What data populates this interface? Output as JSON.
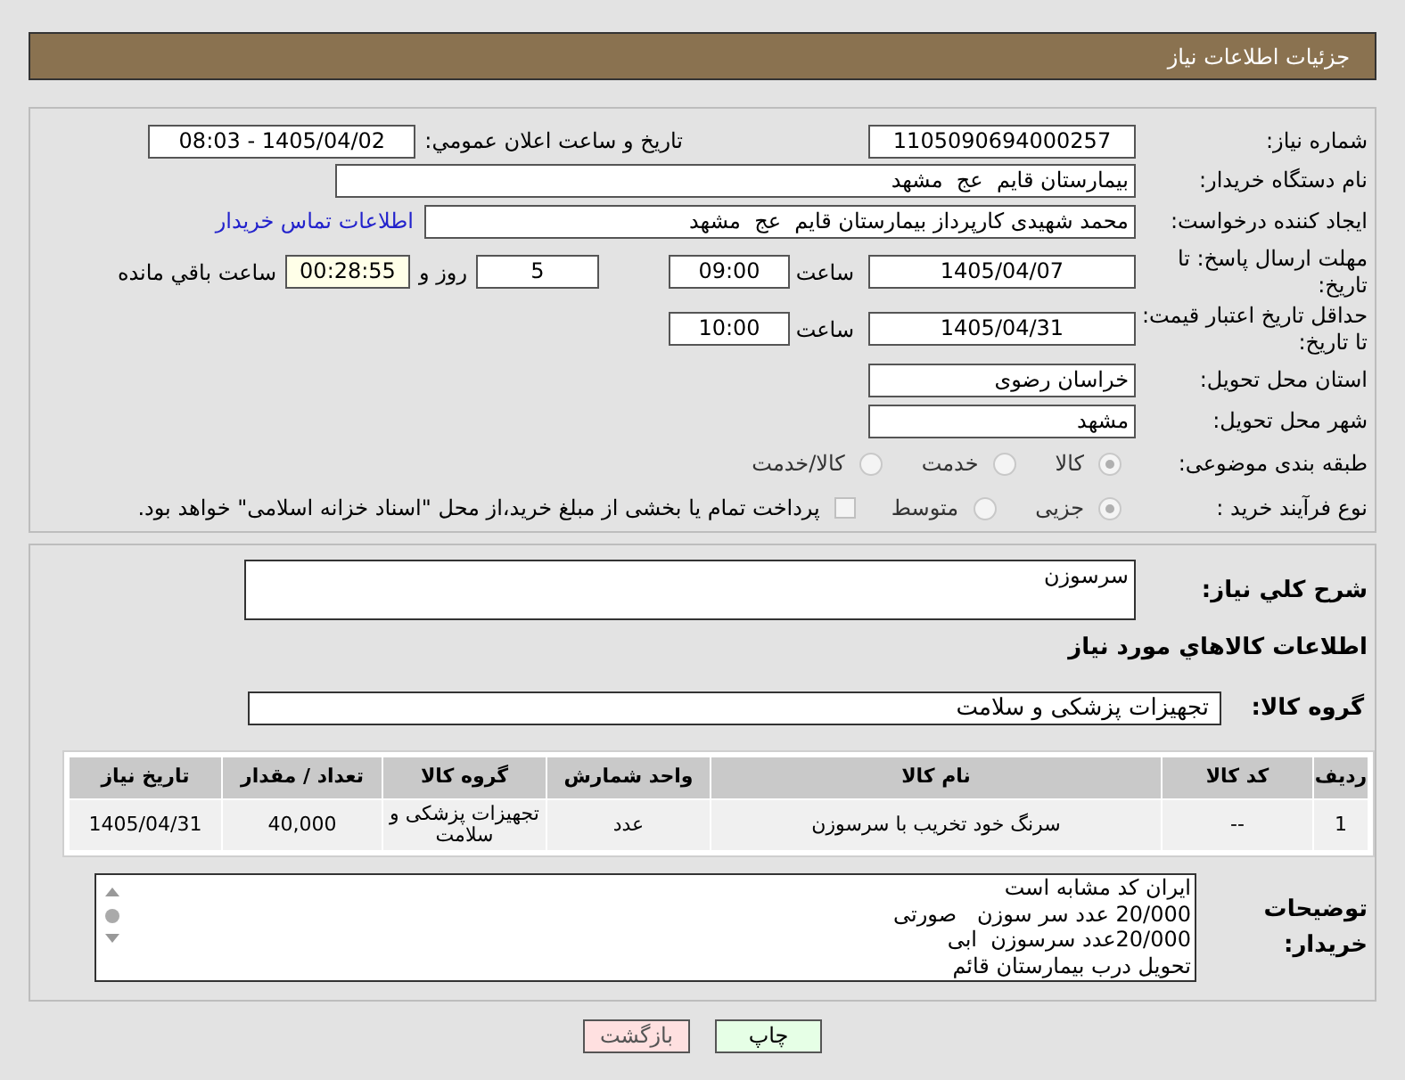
{
  "header": {
    "title": "جزئيات اطلاعات نياز"
  },
  "need_number": {
    "label": "شماره نياز:",
    "value": "1105090694000257"
  },
  "announce": {
    "label": "تاريخ و ساعت اعلان عمومي:",
    "value": "1405/04/02 - 08:03"
  },
  "buyer_org": {
    "label": "نام دستگاه خريدار:",
    "value": "بيمارستان قايم  عج  مشهد"
  },
  "requester": {
    "label": "ايجاد كننده درخواست:",
    "value": "محمد شهيدی كارپرداز بيمارستان قايم  عج  مشهد",
    "contact_link": "اطلاعات تماس خريدار"
  },
  "deadline": {
    "label": "مهلت ارسال پاسخ: تا تاريخ:",
    "date": "1405/04/07",
    "time_label": "ساعت",
    "time": "09:00",
    "days": "5",
    "days_label": "روز و",
    "remaining": "00:28:55",
    "remaining_label": "ساعت باقي مانده"
  },
  "validity": {
    "label": "حداقل تاريخ اعتبار قيمت: تا تاريخ:",
    "date": "1405/04/31",
    "time_label": "ساعت",
    "time": "10:00"
  },
  "province": {
    "label": "استان محل تحويل:",
    "value": "خراسان رضوی"
  },
  "city": {
    "label": "شهر محل تحويل:",
    "value": "مشهد"
  },
  "category": {
    "label": "طبقه بندی موضوعی:",
    "options": [
      {
        "label": "كالا",
        "selected": true
      },
      {
        "label": "خدمت",
        "selected": false
      },
      {
        "label": "كالا/خدمت",
        "selected": false
      }
    ]
  },
  "process": {
    "label": "نوع فرآيند خريد :",
    "options": [
      {
        "label": "جزيی",
        "selected": true
      },
      {
        "label": "متوسط",
        "selected": false
      }
    ],
    "payment": {
      "checked": false,
      "text": "پرداخت تمام يا بخشی از مبلغ خريد،از محل \"اسناد خزانه اسلامی\" خواهد بود."
    }
  },
  "description": {
    "label": "شرح كلي نياز:",
    "value": "سرسوزن"
  },
  "goods_title": "اطلاعات كالاهاي مورد نياز",
  "goods_group": {
    "label": "گروه كالا:",
    "value": "تجهيزات پزشكی و سلامت"
  },
  "table": {
    "columns": [
      "رديف",
      "كد كالا",
      "نام كالا",
      "واحد شمارش",
      "گروه كالا",
      "تعداد / مقدار",
      "تاريخ نياز"
    ],
    "rows": [
      [
        "1",
        "--",
        "سرنگ خود تخريب با سرسوزن",
        "عدد",
        "تجهيزات پزشكی و سلامت",
        "40,000",
        "1405/04/31"
      ]
    ]
  },
  "buyer_notes": {
    "label": "توضيحات خريدار:",
    "lines": [
      "ايران كد مشابه است",
      "20/000 عدد سر سوزن   صورتی",
      "20/000عدد سرسوزن  ابی",
      "تحويل درب بيمارستان قائم"
    ]
  },
  "buttons": [
    {
      "label": "چاپ",
      "kind": "print"
    },
    {
      "label": "بازگشت",
      "kind": "back"
    }
  ]
}
